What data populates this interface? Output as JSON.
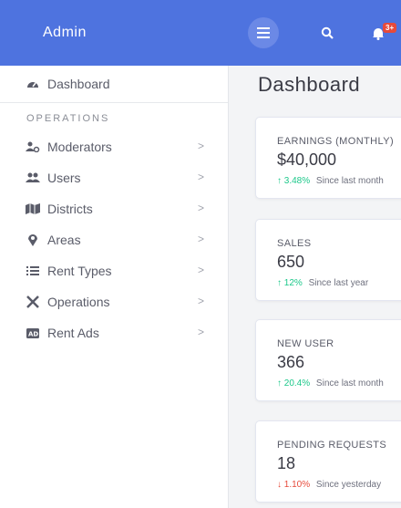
{
  "sidebar": {
    "brand": "Admin",
    "dashboard": "Dashboard",
    "section": "OPERATIONS",
    "items": [
      {
        "label": "Moderators",
        "icon": "users-cog-icon"
      },
      {
        "label": "Users",
        "icon": "users-icon"
      },
      {
        "label": "Districts",
        "icon": "map-icon"
      },
      {
        "label": "Areas",
        "icon": "map-marker-icon"
      },
      {
        "label": "Rent Types",
        "icon": "list-icon"
      },
      {
        "label": "Operations",
        "icon": "tools-icon"
      },
      {
        "label": "Rent Ads",
        "icon": "ad-icon"
      }
    ]
  },
  "topbar": {
    "notification_badge": "3+"
  },
  "main": {
    "title": "Dashboard",
    "cards": [
      {
        "label": "EARNINGS (MONTHLY)",
        "value": "$40,000",
        "change": "3.48%",
        "trend": "up",
        "note": "Since last month"
      },
      {
        "label": "SALES",
        "value": "650",
        "change": "12%",
        "trend": "up",
        "note": "Since last year"
      },
      {
        "label": "NEW USER",
        "value": "366",
        "change": "20.4%",
        "trend": "up",
        "note": "Since last month"
      },
      {
        "label": "PENDING REQUESTS",
        "value": "18",
        "change": "1.10%",
        "trend": "down",
        "note": "Since yesterday"
      }
    ]
  },
  "colors": {
    "primary": "#4e73df",
    "success": "#1cc88a",
    "danger": "#e74a3b"
  }
}
